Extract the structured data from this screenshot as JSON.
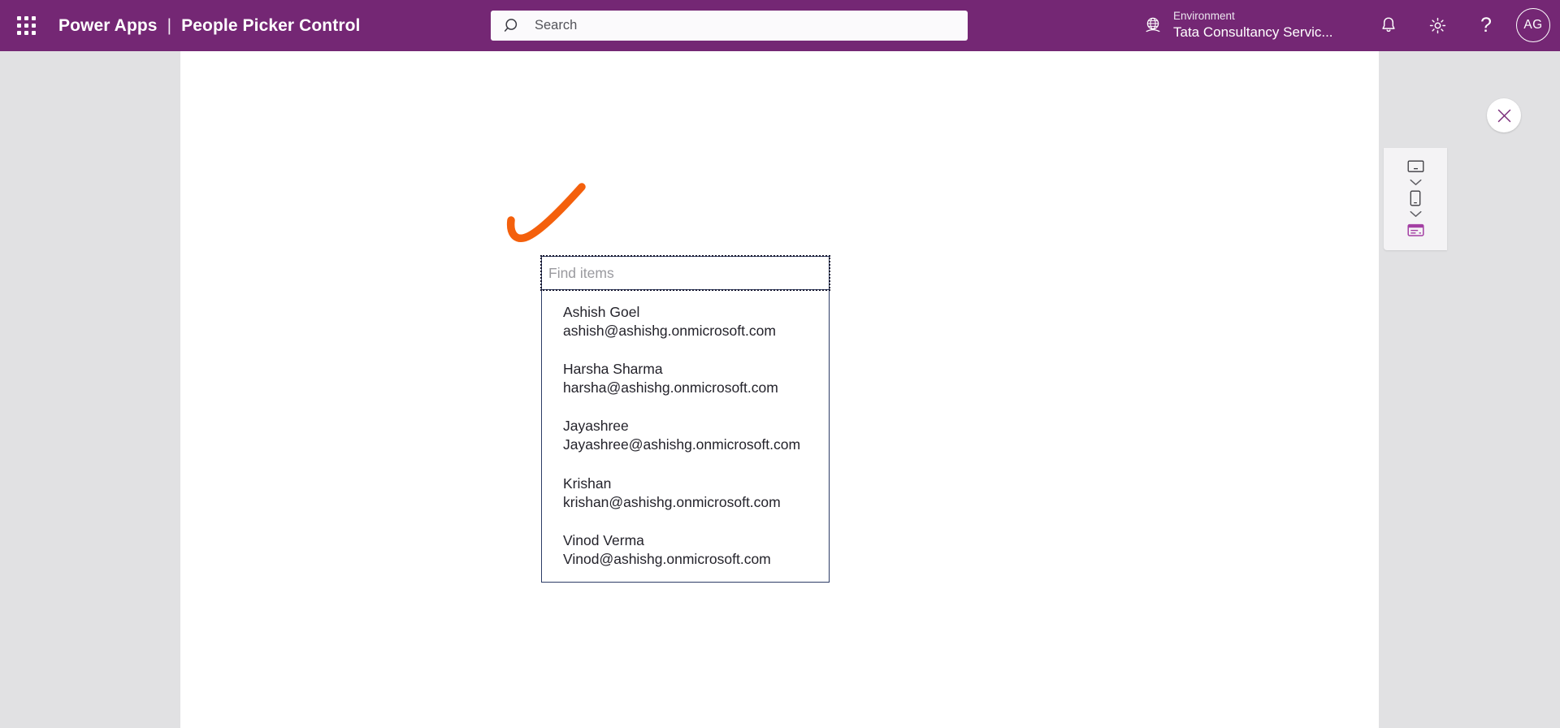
{
  "app": {
    "product_name": "Power Apps",
    "separator": "|",
    "page_title": "People Picker Control",
    "waffle_icon": "app-launcher-grid-icon"
  },
  "search": {
    "placeholder": "Search",
    "value": "",
    "icon": "search-icon"
  },
  "environment": {
    "label": "Environment",
    "name": "Tata Consultancy Servic...",
    "icon": "globe-environment-icon"
  },
  "header_actions": {
    "notifications": {
      "label": "Notifications",
      "icon": "bell-icon"
    },
    "settings": {
      "label": "Settings",
      "icon": "gear-icon"
    },
    "help": {
      "label": "Help",
      "icon": "question-mark-icon",
      "glyph": "?"
    },
    "account": {
      "initials": "AG",
      "label": "Account manager"
    }
  },
  "canvas_actions": {
    "close": {
      "label": "Close",
      "icon": "close-x-icon",
      "glyph": "✕"
    }
  },
  "device_rail": {
    "items": [
      {
        "name": "desktop-preview",
        "icon": "monitor-icon"
      },
      {
        "name": "desktop-size-chevron",
        "icon": "chevron-down-icon"
      },
      {
        "name": "phone-preview",
        "icon": "phone-icon"
      },
      {
        "name": "phone-size-chevron",
        "icon": "chevron-down-icon"
      },
      {
        "name": "keyboard-preview",
        "icon": "keyboard-card-icon"
      }
    ]
  },
  "people_picker": {
    "find_input": {
      "placeholder": "Find items",
      "value": "",
      "selected": true
    },
    "results": [
      {
        "name": "Ashish Goel",
        "email": "ashish@ashishg.onmicrosoft.com"
      },
      {
        "name": "Harsha Sharma",
        "email": "harsha@ashishg.onmicrosoft.com"
      },
      {
        "name": "Jayashree",
        "email": "Jayashree@ashishg.onmicrosoft.com"
      },
      {
        "name": "Krishan",
        "email": "krishan@ashishg.onmicrosoft.com"
      },
      {
        "name": "Vinod Verma",
        "email": "Vinod@ashishg.onmicrosoft.com"
      }
    ]
  },
  "annotation": {
    "type": "hand-drawn-check-stroke",
    "color": "#f4600c"
  },
  "colors": {
    "brand_purple": "#742774",
    "stage_gray": "#e1e1e3",
    "canvas_white": "#ffffff",
    "control_border": "#2d3c66",
    "annotation_orange": "#f4600c",
    "placeholder_gray": "#9a9a9f"
  }
}
